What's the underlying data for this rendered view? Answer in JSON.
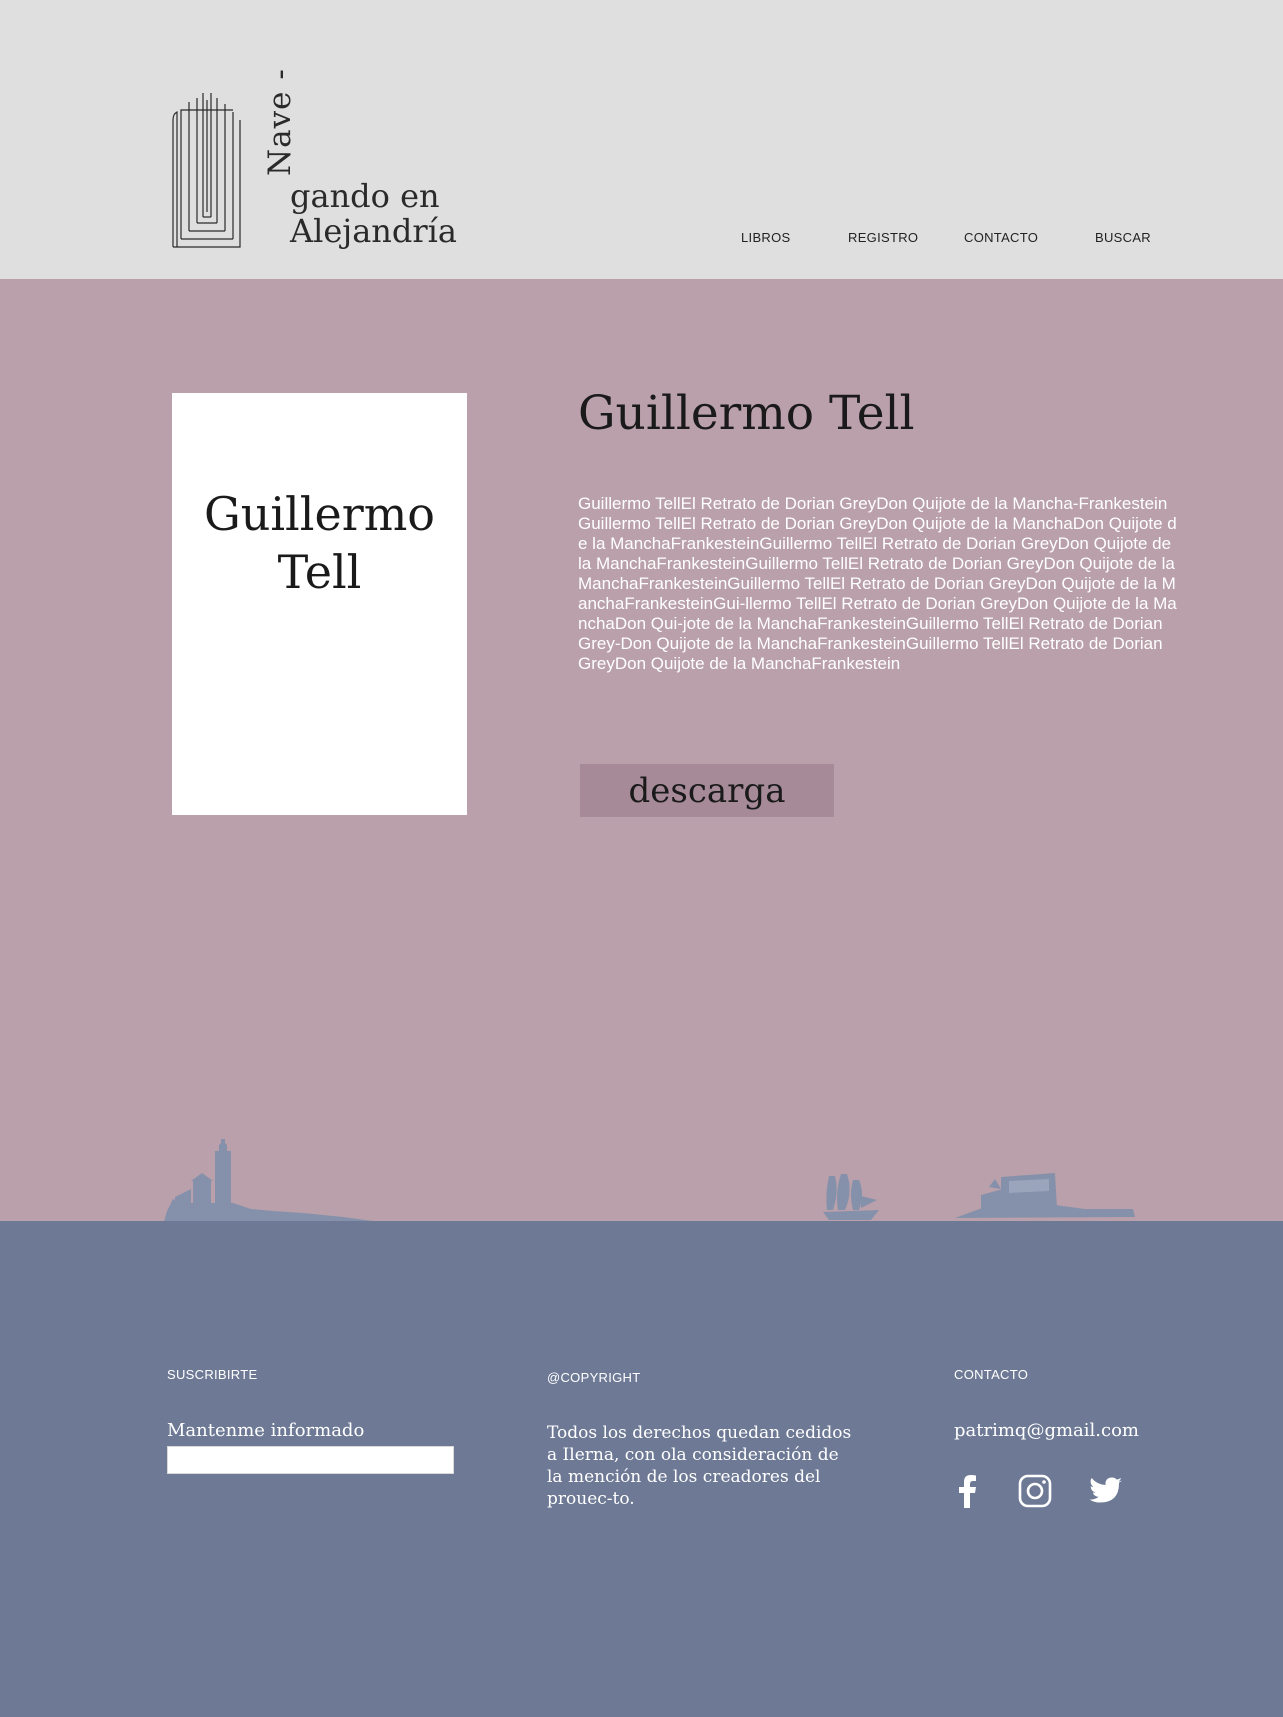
{
  "header": {
    "logo": {
      "vertical": "Nave -",
      "line1": "gando en",
      "line2": "Alejandría"
    },
    "nav": [
      {
        "label": "LIBROS"
      },
      {
        "label": "REGISTRO"
      },
      {
        "label": "CONTACTO"
      },
      {
        "label": "BUSCAR"
      }
    ]
  },
  "book": {
    "cover_line1": "Guillermo",
    "cover_line2": "Tell",
    "title": "Guillermo Tell",
    "description": "Guillermo TellEl Retrato de Dorian GreyDon Quijote de la Mancha-FrankesteinGuillermo TellEl Retrato de Dorian GreyDon Quijote de la ManchaDon Quijote de la ManchaFrankesteinGuillermo TellEl Retrato de Dorian GreyDon Quijote de la ManchaFrankesteinGuillermo TellEl Retrato de Dorian GreyDon Quijote de la ManchaFrankesteinGuillermo TellEl Retrato de Dorian GreyDon Quijote de la ManchaFrankesteinGui-llermo TellEl Retrato de Dorian GreyDon Quijote de la ManchaDon Qui-jote de la ManchaFrankesteinGuillermo TellEl Retrato de Dorian Grey-Don Quijote de la ManchaFrankesteinGuillermo TellEl Retrato de Dorian GreyDon Quijote de la ManchaFrankestein",
    "download_label": "descarga"
  },
  "footer": {
    "subscribe": {
      "heading": "SUSCRIBIRTE",
      "label": "Mantenme informado",
      "placeholder": ""
    },
    "copyright": {
      "heading": "@COPYRIGHT",
      "text": "Todos los derechos quedan cedidos a Ilerna, con ola consideración de la mención de los creadores del prouec-to."
    },
    "contact": {
      "heading": "CONTACTO",
      "email": "patrimq@gmail.com"
    },
    "social": [
      "facebook-icon",
      "instagram-icon",
      "twitter-icon"
    ]
  },
  "colors": {
    "header_bg": "#dfdfdf",
    "main_bg": "#b9a0aa",
    "footer_bg": "#6e7a95",
    "button_bg": "#a78a98",
    "silhouette": "#8591ab"
  }
}
